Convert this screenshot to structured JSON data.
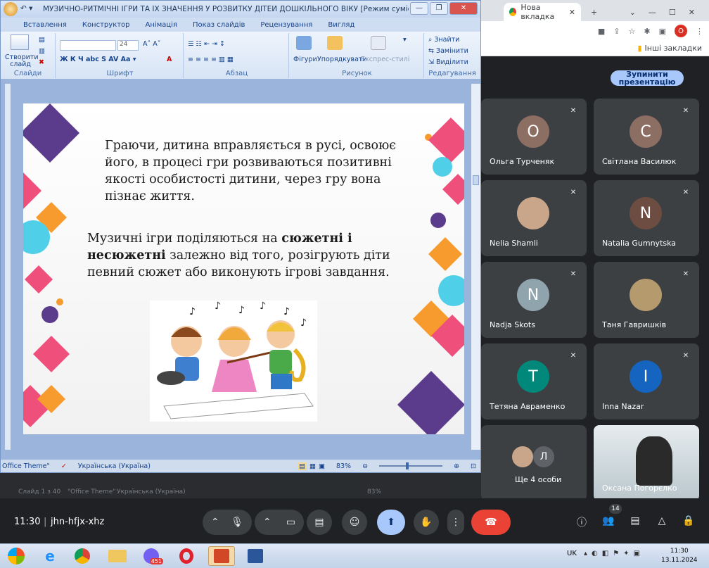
{
  "chrome": {
    "tab_label": "Нова вкладка",
    "new_tab": "+",
    "profile": "О",
    "bookmarks": "Інші закладки"
  },
  "meet": {
    "stop_presenting": "Зупинити презентацію",
    "time": "11:30",
    "code": "jhn-hfjx-xhz",
    "participant_count": "14",
    "participants": [
      {
        "name": "Ольга Турченяк",
        "initial": "О",
        "color": "#8d6e63"
      },
      {
        "name": "Світлана Василюк",
        "initial": "С",
        "color": "#8d6e63"
      },
      {
        "name": "Nelia Shamli",
        "initial": "",
        "color": "#c9a68a"
      },
      {
        "name": "Natalia Gumnytska",
        "initial": "N",
        "color": "#6d4c41"
      },
      {
        "name": "Nadja Skots",
        "initial": "N",
        "color": "#90a4ae"
      },
      {
        "name": "Таня Гавришків",
        "initial": "",
        "color": "#b59a6d"
      },
      {
        "name": "Тетяна Авраменко",
        "initial": "T",
        "color": "#00897b"
      },
      {
        "name": "Inna Nazar",
        "initial": "I",
        "color": "#1565c0"
      },
      {
        "name": "Ще 4 особи",
        "initial": "Л",
        "color": "#5f6368"
      },
      {
        "name": "Оксана Погорєлко",
        "initial": "",
        "color": "#cfd8dc"
      }
    ]
  },
  "ppt": {
    "title": "МУЗИЧНО-РИТМІЧНІ ІГРИ ТА ЇХ ЗНАЧЕННЯ У РОЗВИТКУ ДІТЕЙ ДОШКІЛЬНОГО ВІКУ [Режим сумісності] - Microsoft...",
    "tabs": [
      "Вставлення",
      "Конструктор",
      "Анімація",
      "Показ слайдів",
      "Рецензування",
      "Вигляд"
    ],
    "groups": {
      "slides": "Слайди",
      "font": "Шрифт",
      "paragraph": "Абзац",
      "drawing": "Рисунок",
      "editing": "Редагування"
    },
    "buttons": {
      "new_slide": "Створити слайд",
      "shapes": "Фігури",
      "arrange": "Упорядкувати",
      "quick_styles": "Експрес-стилі",
      "find": "Знайти",
      "replace": "Замінити",
      "select": "Виділити",
      "font_size": "24"
    },
    "slide": {
      "text1": "Граючи, дитина вправляється в русі, освоює його, в процесі гри розвиваються позитивні якості особистості дитини, через гру вона пізнає життя.",
      "text2_a": "Музичні ігри поділяються на ",
      "text2_b": "сюжетні і несюжетні",
      "text2_c": "  залежно від того, розігрують діти певний сюжет або виконують ігрові завдання."
    },
    "status": {
      "theme": "Office Theme\"",
      "language": "Українська (Україна)",
      "zoom": "83%",
      "ghost_slide": "Слайд 1 з 40",
      "ghost_theme": "\"Office Theme\"",
      "ghost_lang": "Українська (Україна)",
      "ghost_zoom": "83%"
    }
  },
  "taskbar": {
    "lang": "UK",
    "time": "11:30",
    "date": "13.11.2024",
    "viber_badge": "451"
  }
}
